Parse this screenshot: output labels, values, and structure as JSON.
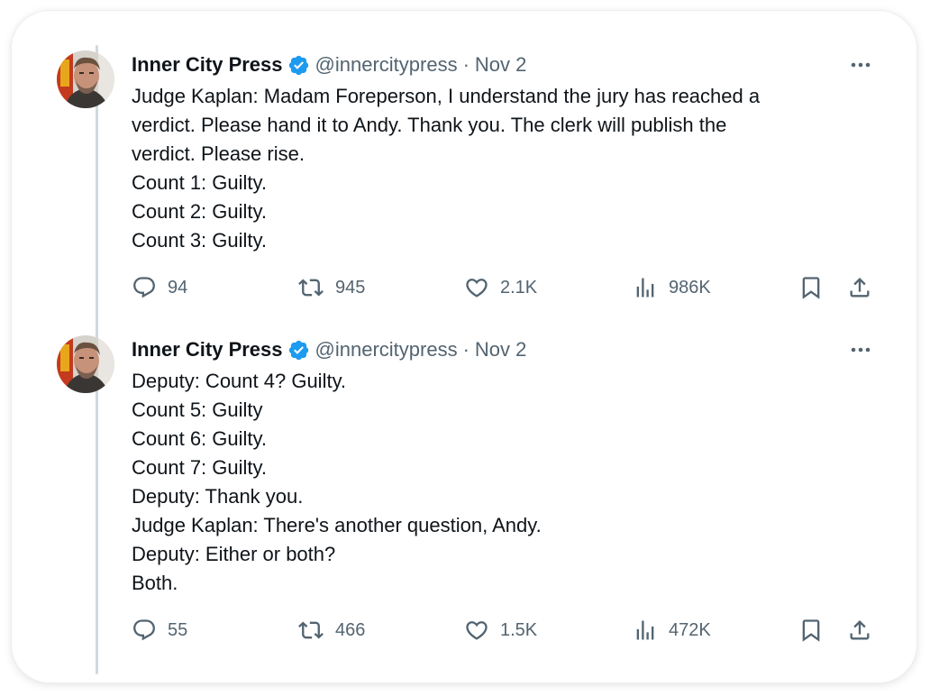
{
  "tweets": [
    {
      "author": {
        "name": "Inner City Press",
        "handle": "@innercitypress",
        "verified": true,
        "avatar_icon": "profile-photo"
      },
      "separator": "·",
      "date": "Nov 2",
      "lines": [
        "Judge Kaplan: Madam Foreperson, I understand the jury has reached a",
        "verdict. Please hand it to Andy. Thank you. The clerk will publish the",
        "verdict. Please rise.",
        "Count 1: Guilty.",
        "Count 2: Guilty.",
        "Count 3: Guilty."
      ],
      "stats": {
        "replies": "94",
        "retweets": "945",
        "likes": "2.1K",
        "views": "986K"
      }
    },
    {
      "author": {
        "name": "Inner City Press",
        "handle": "@innercitypress",
        "verified": true,
        "avatar_icon": "profile-photo"
      },
      "separator": "·",
      "date": "Nov 2",
      "lines": [
        "Deputy: Count 4? Guilty.",
        "Count 5: Guilty",
        "Count 6: Guilty.",
        "Count 7: Guilty.",
        "Deputy: Thank you.",
        "Judge Kaplan: There's another question, Andy.",
        "Deputy: Either or both?",
        "Both."
      ],
      "stats": {
        "replies": "55",
        "retweets": "466",
        "likes": "1.5K",
        "views": "472K"
      }
    }
  ],
  "icons": {
    "verified": "verified-badge-icon",
    "more": "more-icon",
    "reply": "reply-icon",
    "retweet": "retweet-icon",
    "like": "heart-icon",
    "views": "views-icon",
    "bookmark": "bookmark-icon",
    "share": "share-icon"
  },
  "colors": {
    "text": "#0f1419",
    "secondary": "#536471",
    "verified": "#1d9bf0",
    "thread_line": "#cfd9de"
  }
}
